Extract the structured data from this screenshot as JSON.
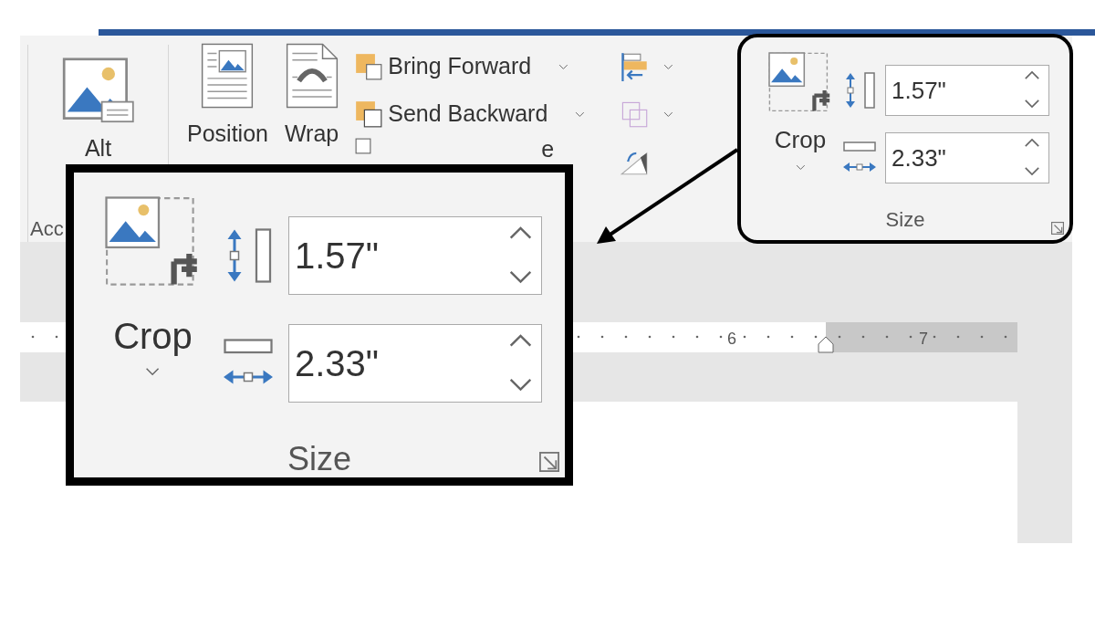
{
  "ribbon": {
    "accessibility_group": {
      "button": {
        "label": "Alt"
      },
      "label": "Acc"
    },
    "arrange_group": {
      "large_buttons": [
        {
          "kind": "position",
          "label": "Position"
        },
        {
          "kind": "wrap",
          "label": "Wrap"
        }
      ],
      "commands": [
        {
          "kind": "forward",
          "label": "Bring Forward"
        },
        {
          "kind": "backward",
          "label": "Send Backward"
        },
        {
          "kind": "selection",
          "label": "e"
        }
      ]
    },
    "size_group": {
      "crop_label": "Crop",
      "height": "1.57\"",
      "width": "2.33\"",
      "label": "Size"
    }
  },
  "callout": {
    "crop_label": "Crop",
    "height": "1.57\"",
    "width": "2.33\"",
    "label": "Size"
  },
  "ruler": {
    "labels": [
      "6",
      "7"
    ]
  }
}
